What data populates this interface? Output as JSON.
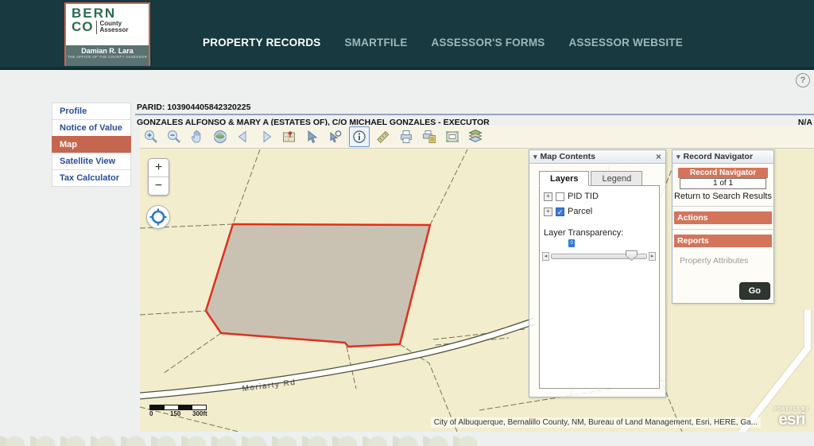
{
  "header": {
    "logo": {
      "line1": "BERN",
      "line2": "CO",
      "sub1": "County",
      "sub2": "Assessor",
      "name": "Damian R. Lara",
      "tagline": "THE OFFICE OF THE COUNTY ASSESSOR"
    },
    "nav": [
      {
        "label": "PROPERTY RECORDS",
        "active": true
      },
      {
        "label": "SMARTFILE"
      },
      {
        "label": "ASSESSOR'S FORMS"
      },
      {
        "label": "ASSESSOR WEBSITE"
      }
    ],
    "help_icon": "?"
  },
  "sidebar": {
    "items": [
      {
        "label": "Profile"
      },
      {
        "label": "Notice of Value"
      },
      {
        "label": "Map",
        "active": true
      },
      {
        "label": "Satellite View"
      },
      {
        "label": "Tax Calculator"
      }
    ]
  },
  "record_header": {
    "parid_line": "PARID: 103904405842320225",
    "owner_line": "GONZALES ALFONSO & MARY A (ESTATES OF), C/O MICHAEL GONZALES - EXECUTOR",
    "right_value": "N/A"
  },
  "toolbar": {
    "tools": [
      {
        "name": "zoom-in"
      },
      {
        "name": "zoom-out"
      },
      {
        "name": "pan"
      },
      {
        "name": "full-extent"
      },
      {
        "name": "previous-extent"
      },
      {
        "name": "next-extent"
      },
      {
        "name": "locate-map"
      },
      {
        "name": "select"
      },
      {
        "name": "identify"
      },
      {
        "name": "info",
        "active": true
      },
      {
        "name": "measure"
      },
      {
        "name": "print"
      },
      {
        "name": "export"
      },
      {
        "name": "overview"
      },
      {
        "name": "layers"
      }
    ]
  },
  "map": {
    "zoom_in": "+",
    "zoom_out": "−",
    "road_label": "Moriarty Rd",
    "scale": {
      "t0": "0",
      "t1": "150",
      "t2": "300ft"
    },
    "attribution": "City of Albuquerque, Bernalillo County, NM, Bureau of Land Management, Esri, HERE, Ga...",
    "esri_powered": "POWERED BY",
    "esri_logo": "esri"
  },
  "map_contents": {
    "title": "Map Contents",
    "tabs": [
      {
        "label": "Layers",
        "active": true
      },
      {
        "label": "Legend"
      }
    ],
    "layers": [
      {
        "label": "PID TID",
        "checked": false
      },
      {
        "label": "Parcel",
        "checked": true
      }
    ],
    "transparency_label": "Layer Transparency:",
    "transparency_value": "0"
  },
  "record_navigator": {
    "title": "Record Navigator",
    "bar_label": "Record Navigator",
    "position": "1 of 1",
    "return_link": "Return to Search Results",
    "actions_label": "Actions",
    "reports_label": "Reports",
    "report_links": [
      "Property Attributes"
    ],
    "go_label": "Go"
  },
  "icons": {
    "collapse": "▾",
    "close": "×",
    "expand": "+",
    "check": "✓",
    "slider_left": "◂",
    "slider_right": "▸"
  },
  "colors": {
    "header_teal": "#17393f",
    "salmon": "#c4674e",
    "panel_bar": "#d4745b",
    "map_bg": "#f1edcd",
    "parcel_fill": "#c9c2b2",
    "parcel_outline": "#e0301f",
    "link_blue": "#2b4d96",
    "go_button": "#2e362f"
  }
}
